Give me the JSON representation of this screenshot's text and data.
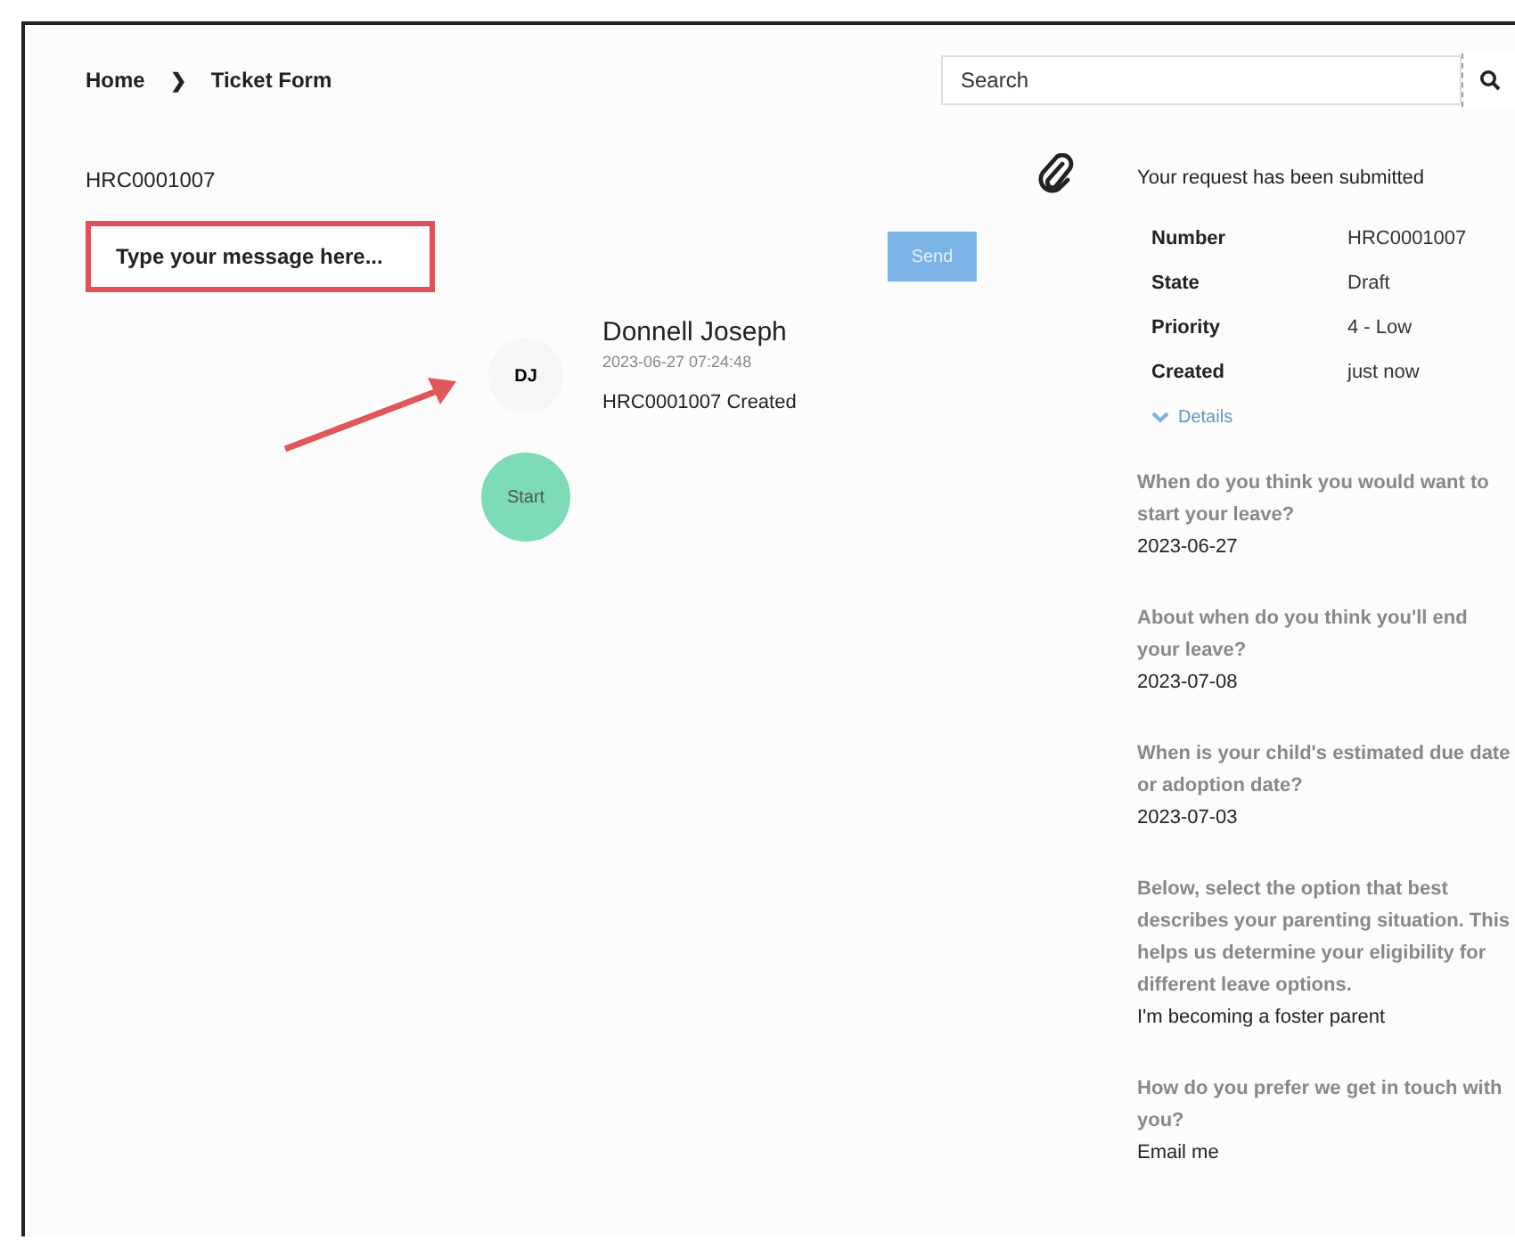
{
  "breadcrumb": [
    {
      "label": "Home"
    },
    {
      "label": "Ticket Form"
    }
  ],
  "breadcrumb_separator": "❯",
  "search": {
    "placeholder": "Search"
  },
  "ticket": {
    "number": "HRC0001007"
  },
  "message": {
    "placeholder": "Type your message here...",
    "highlighted": true
  },
  "send_button": {
    "label": "Send",
    "disabled": true
  },
  "activity": {
    "initials": "DJ",
    "author": "Donnell Joseph",
    "timestamp": "2023-06-27 07:24:48",
    "text": "HRC0001007 Created"
  },
  "start_marker": {
    "label": "Start"
  },
  "summary": {
    "title": "Your request has been submitted",
    "fields": [
      {
        "label": "Number",
        "value": "HRC0001007"
      },
      {
        "label": "State",
        "value": "Draft"
      },
      {
        "label": "Priority",
        "value": "4 - Low"
      },
      {
        "label": "Created",
        "value": "just now"
      }
    ],
    "details_link": {
      "label": "Details",
      "expanded": false
    }
  },
  "answers": [
    {
      "question": "When do you think you would want to start your leave?",
      "answer": "2023-06-27"
    },
    {
      "question": "About when do you think you'll end your leave?",
      "answer": "2023-07-08"
    },
    {
      "question": "When is your child's estimated due date or adoption date?",
      "answer": "2023-07-03"
    },
    {
      "question": "Below, select the option that best describes your parenting situation. This helps us determine your eligibility for different leave options.",
      "answer": "I'm becoming a foster parent"
    },
    {
      "question": "How do you prefer we get in touch with you?",
      "answer": "Email me"
    }
  ]
}
